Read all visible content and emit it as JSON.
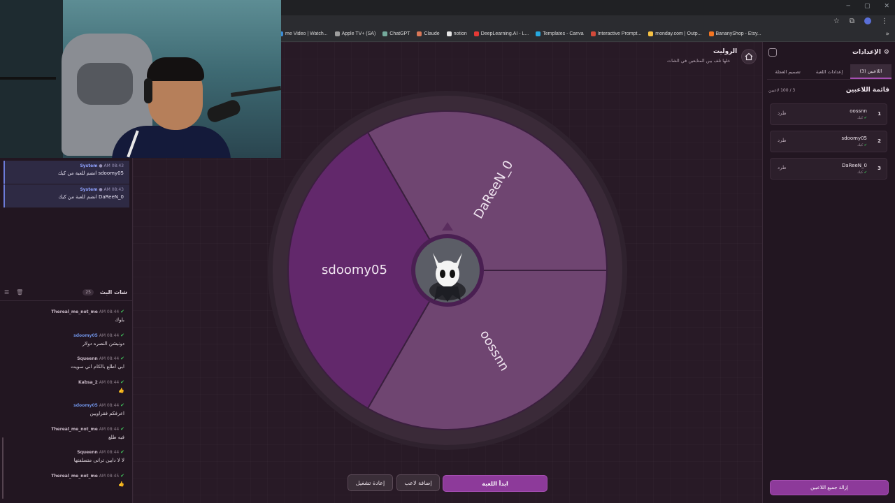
{
  "browser": {
    "bookmarks": [
      "me Video | Watch...",
      "Apple TV+ (SA)",
      "ChatGPT",
      "Claude",
      "notion",
      "DeepLearning.AI - L...",
      "Templates - Canva",
      "Interactive Prompt...",
      "monday.com | Outp...",
      "BananyShop - Etsy..."
    ],
    "bookmark_colors": [
      "#3c8dd8",
      "#9e9e9e",
      "#74aa9c",
      "#d97757",
      "#e6e6e6",
      "#e53935",
      "#26a9e0",
      "#d34a3a",
      "#f6c244",
      "#f47521"
    ]
  },
  "system_messages": [
    {
      "time": "AM 08:43",
      "author": "System",
      "text": "sdoomy05 انضم للعبة من كيك"
    },
    {
      "time": "AM 08:43",
      "author": "System",
      "text": "DaReeN_0 انضم للعبة من كيك"
    }
  ],
  "chat": {
    "title": "شات البث",
    "count": "25",
    "messages": [
      {
        "time": "AM 08:44",
        "user": "Thereal_me_not_me",
        "blue": false,
        "text": "بلوك"
      },
      {
        "time": "AM 08:44",
        "user": "sdoomy05",
        "blue": true,
        "text": "دونيشن النصره دولار"
      },
      {
        "time": "AM 08:44",
        "user": "Squeenn",
        "blue": false,
        "text": "ابي اطلع بالكام اني سويت"
      },
      {
        "time": "AM 08:44",
        "user": "Kabsa_2",
        "blue": false,
        "text": "👍"
      },
      {
        "time": "AM 08:44",
        "user": "sdoomy05",
        "blue": true,
        "text": "اعرفكم فقراويين"
      },
      {
        "time": "AM 08:44",
        "user": "Thereal_me_not_me",
        "blue": false,
        "text": "فيه طلع"
      },
      {
        "time": "AM 08:44",
        "user": "Squeenn",
        "blue": false,
        "text": "لا لا دايين ترانى متسلفتها"
      },
      {
        "time": "AM 08:45",
        "user": "Thereal_me_not_me",
        "blue": false,
        "text": "👍"
      }
    ]
  },
  "header": {
    "title": "الروليت",
    "subtitle": "خلها تلف بين المتابعين في الشات"
  },
  "wheel": {
    "segments": [
      {
        "name": "DaReeN_0",
        "color": "#6f4571"
      },
      {
        "name": "oossnn",
        "color": "#6f4571"
      },
      {
        "name": "sdoomy05",
        "color": "#62286b"
      }
    ],
    "outer_ring": "#3a2a38"
  },
  "actions": {
    "restart": "إعادة تشغيل",
    "add_player": "إضافة لاعب",
    "start": "ابدأ اللعبة"
  },
  "settings": {
    "title": "الإعدادات",
    "tabs": [
      "اللاعبين (3)",
      "إعدادات اللعبة",
      "تصميم العجلة"
    ],
    "list_title": "قائمة اللاعبين",
    "count": "3 / 100 لاعبين",
    "players": [
      {
        "num": "1",
        "name": "oossnn",
        "source": "كيك",
        "kick": "طرد"
      },
      {
        "num": "2",
        "name": "sdoomy05",
        "source": "كيك",
        "kick": "طرد"
      },
      {
        "num": "3",
        "name": "DaReeN_0",
        "source": "كيك",
        "kick": "طرد"
      }
    ],
    "remove_all": "إزالة جميع اللاعبين"
  }
}
